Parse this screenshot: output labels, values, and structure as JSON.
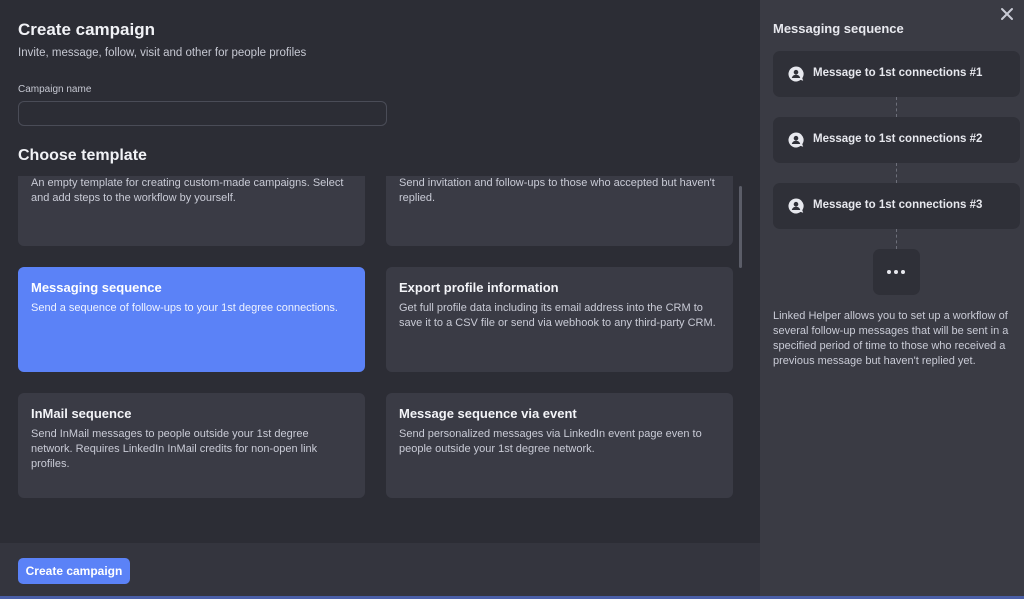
{
  "main": {
    "title": "Create campaign",
    "subtitle": "Invite, message, follow, visit and other for people profiles",
    "campaign_name_label": "Campaign name",
    "campaign_name_value": "",
    "campaign_name_placeholder": "",
    "choose_template_label": "Choose template",
    "templates": [
      {
        "title": "",
        "desc": "An empty template for creating custom-made campaigns. Select and add steps to the workflow by yourself.",
        "selected": false
      },
      {
        "title": "",
        "desc": "Send invitation and follow-ups to those who accepted but haven't replied.",
        "selected": false
      },
      {
        "title": "Messaging sequence",
        "desc": "Send a sequence of follow-ups to your 1st degree connections.",
        "selected": true
      },
      {
        "title": "Export profile information",
        "desc": "Get full profile data including its email address into the CRM to save it to a CSV file or send via webhook to any third-party CRM.",
        "selected": false
      },
      {
        "title": "InMail sequence",
        "desc": "Send InMail messages to people outside your 1st degree network. Requires LinkedIn InMail credits for non-open link profiles.",
        "selected": false
      },
      {
        "title": "Message sequence via event",
        "desc": "Send personalized messages via LinkedIn event page even to people outside your 1st degree network.",
        "selected": false
      }
    ],
    "create_button_label": "Create campaign"
  },
  "side": {
    "title": "Messaging sequence",
    "close_icon": "close-icon",
    "steps": [
      {
        "label": "Message to 1st connections #1",
        "icon": "message-person-icon"
      },
      {
        "label": "Message to 1st connections #2",
        "icon": "message-person-icon"
      },
      {
        "label": "Message to 1st connections #3",
        "icon": "message-person-icon"
      }
    ],
    "more_icon": "more-dots-icon",
    "description": "Linked Helper allows you to set up a workflow of several follow-up messages that will be sent in a specified period of time to those who received a previous message but haven't replied yet."
  },
  "colors": {
    "accent": "#5b82f7",
    "background": "#2c2d35",
    "card": "#3a3b45",
    "side_panel": "#3a3b44"
  }
}
